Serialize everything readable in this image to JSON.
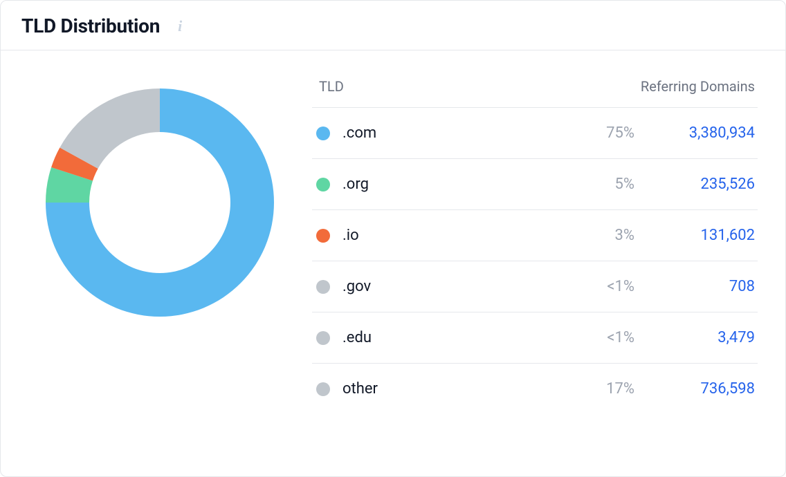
{
  "header": {
    "title": "TLD Distribution"
  },
  "columns": {
    "tld": "TLD",
    "referring": "Referring Domains"
  },
  "rows": [
    {
      "label": ".com",
      "percent": "75%",
      "value": "3,380,934",
      "color": "#5ab8f0"
    },
    {
      "label": ".org",
      "percent": "5%",
      "value": "235,526",
      "color": "#5fd6a3"
    },
    {
      "label": ".io",
      "percent": "3%",
      "value": "131,602",
      "color": "#f26b3a"
    },
    {
      "label": ".gov",
      "percent": "<1%",
      "value": "708",
      "color": "#c0c6cc"
    },
    {
      "label": ".edu",
      "percent": "<1%",
      "value": "3,479",
      "color": "#c0c6cc"
    },
    {
      "label": "other",
      "percent": "17%",
      "value": "736,598",
      "color": "#c0c6cc"
    }
  ],
  "chart_data": {
    "type": "pie",
    "title": "TLD Distribution",
    "series": [
      {
        "name": ".com",
        "value": 75,
        "color": "#5ab8f0"
      },
      {
        "name": ".org",
        "value": 5,
        "color": "#5fd6a3"
      },
      {
        "name": ".io",
        "value": 3,
        "color": "#f26b3a"
      },
      {
        "name": "other/.gov/.edu",
        "value": 17,
        "color": "#c0c6cc"
      }
    ],
    "donut": true
  }
}
